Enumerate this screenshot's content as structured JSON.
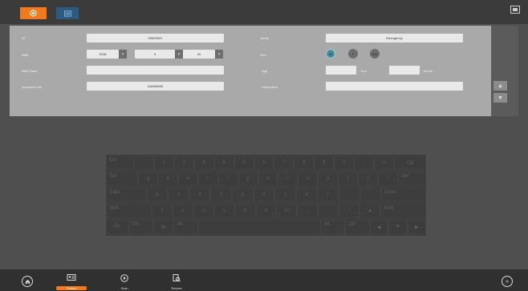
{
  "topbar": {
    "btn1_icon": "target-icon",
    "btn2_icon": "id-card-icon",
    "right_icon": "screen-icon"
  },
  "form": {
    "id_label": "ID",
    "id_value": "00009001",
    "name_label": "Name",
    "name_value": "Emergency",
    "birth_label": "Birth",
    "birth_year": "2018",
    "birth_month": "3",
    "birth_day": "10",
    "sex_label": "Sex",
    "sex_options": [
      "M",
      "F",
      "N/A"
    ],
    "birthplace_label": "Birth Place",
    "birthplace_value": "",
    "age_label": "Age",
    "age_year_value": "",
    "age_year_unit": "Year",
    "age_month_value": "",
    "age_month_unit": "Month",
    "accession_label": "Accession No.",
    "accession_value": "AN000083",
    "description_label": "Description",
    "description_value": ""
  },
  "side": {
    "up_symbol": "▲",
    "down_symbol": "▼"
  },
  "keyboard": {
    "rows": [
      [
        "Esc",
        "`",
        "1",
        "2",
        "3",
        "4",
        "5",
        "6",
        "7",
        "8",
        "9",
        "0",
        "-",
        "=",
        "⌫"
      ],
      [
        "Tab",
        "q",
        "w",
        "e",
        "r",
        "t",
        "y",
        "u",
        "i",
        "o",
        "p",
        "[",
        "]",
        "\\",
        "Del"
      ],
      [
        "Caps",
        "a",
        "s",
        "d",
        "f",
        "g",
        "h",
        "j",
        "k",
        "l",
        ";",
        "'",
        "Enter"
      ],
      [
        "Shift",
        "z",
        "x",
        "c",
        "v",
        "b",
        "n",
        "m",
        ",",
        ".",
        "/",
        "▲",
        "Shift"
      ],
      [
        "Fn",
        "Ctrl",
        "⊞",
        "Alt",
        "",
        "Alt",
        "Ctrl",
        "◀",
        "▼",
        "▶"
      ]
    ]
  },
  "bottom": {
    "home_icon": "home-icon",
    "nav_items": [
      {
        "icon": "patient-card-icon",
        "label": "Patient"
      },
      {
        "icon": "play-circle-icon",
        "label": "Scan"
      },
      {
        "icon": "review-icon",
        "label": "Review"
      }
    ],
    "next_icon": "fast-forward-icon"
  },
  "colors": {
    "accent": "#f07a1d",
    "panel": "#a9a9a9",
    "field": "#e9e9e9",
    "sex_m": "#4d8a99"
  }
}
